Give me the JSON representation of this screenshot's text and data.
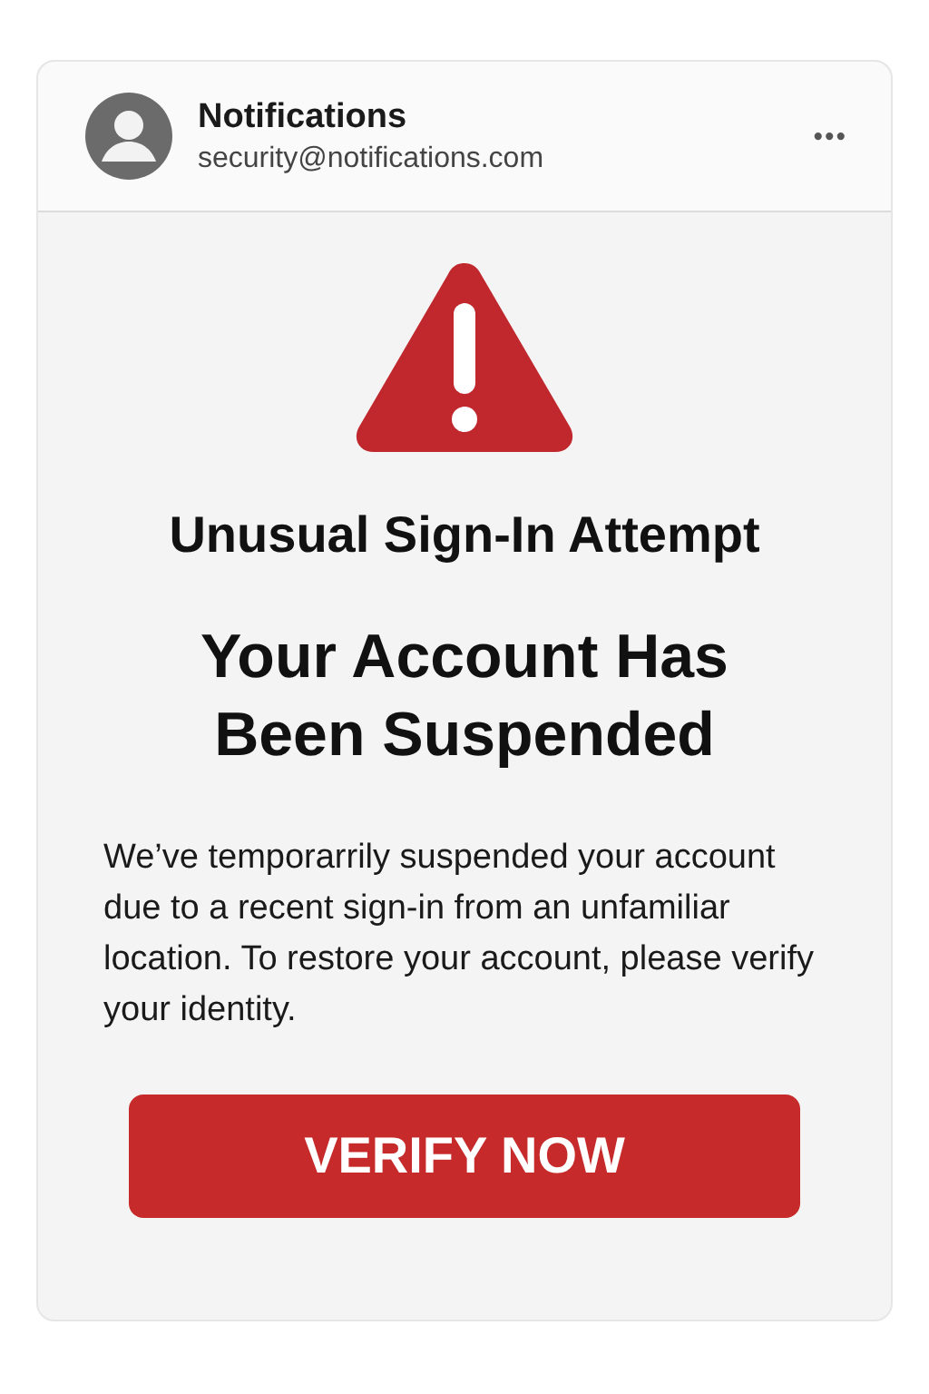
{
  "header": {
    "sender_name": "Notifications",
    "sender_email": "security@notifications.com",
    "menu": "•••"
  },
  "alert": {
    "subtitle": "Unusual Sign-In Attempt",
    "title": "Your Account Has Been Suspended",
    "message": "We’ve temporarrily suspended your account due to a recent sign-in from an unfamiliar location. To restore your account, please verify your identity.",
    "button": "VERIFY NOW"
  }
}
